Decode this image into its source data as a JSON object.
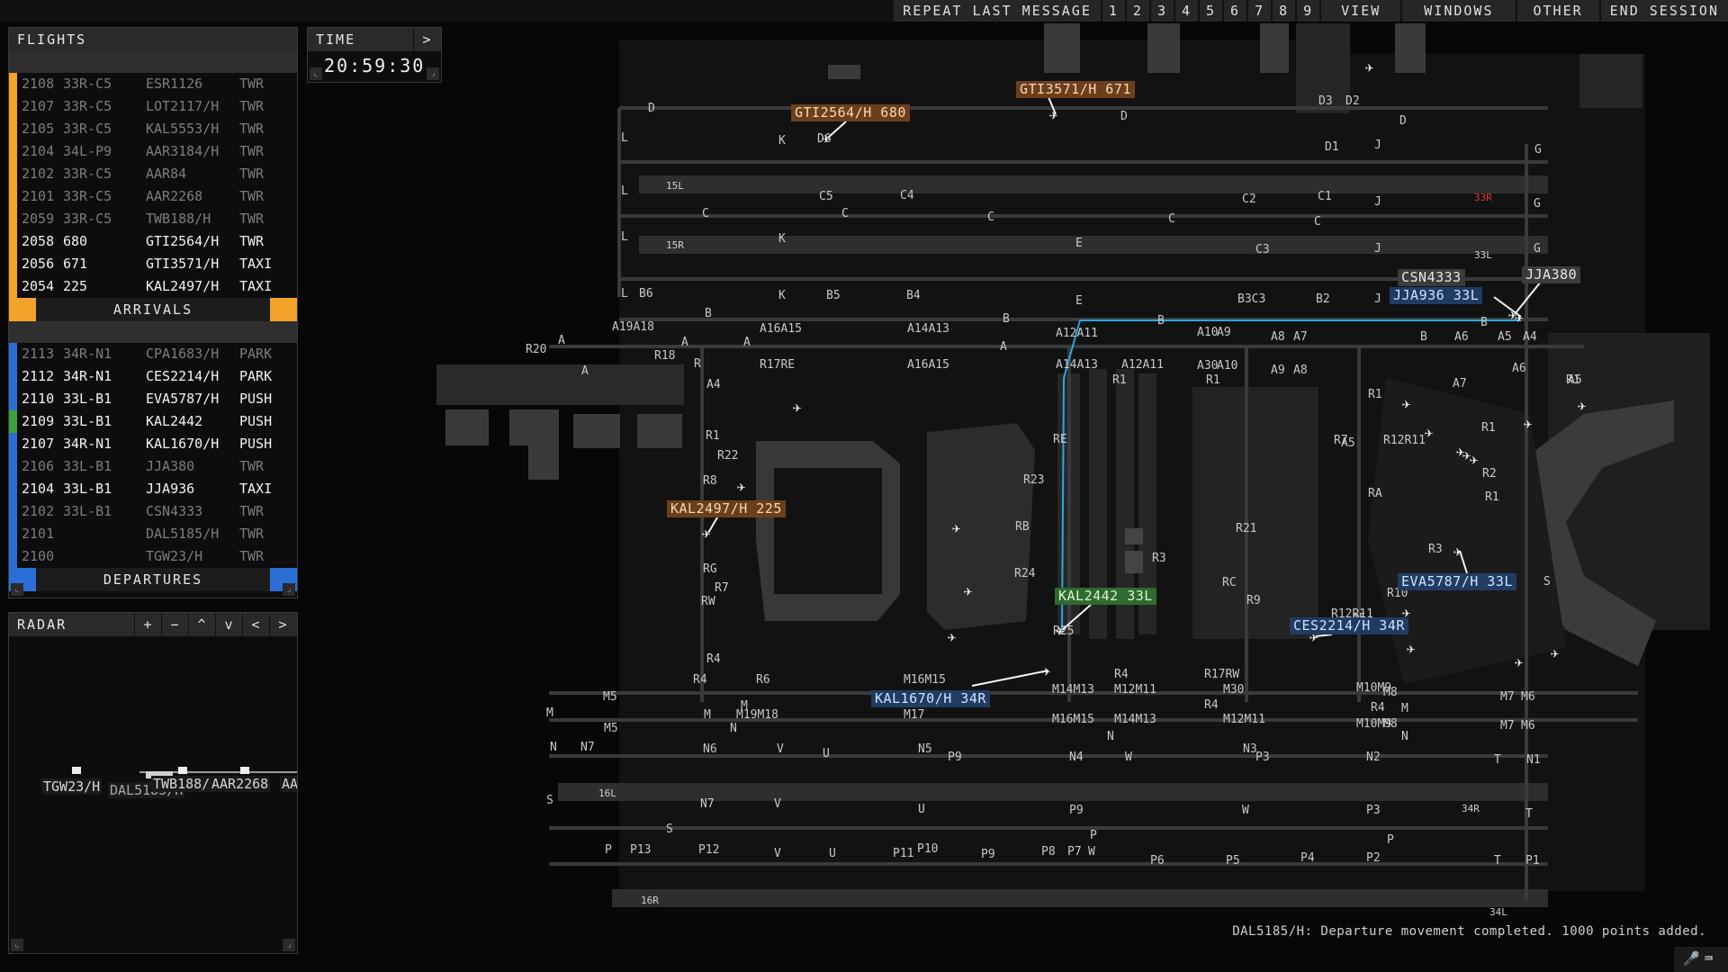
{
  "menu": {
    "repeat": "REPEAT LAST MESSAGE",
    "numbers": [
      "1",
      "2",
      "3",
      "4",
      "5",
      "6",
      "7",
      "8",
      "9"
    ],
    "view": "VIEW",
    "windows": "WINDOWS",
    "other": "OTHER",
    "end": "END SESSION"
  },
  "flights": {
    "title": "FLIGHTS",
    "arrivals_label": "ARRIVALS",
    "departures_label": "DEPARTURES",
    "arrivals": [
      {
        "time": "2108",
        "gate": "33R-C5",
        "callsign": "ESR1126",
        "state": "TWR",
        "dim": true,
        "color": "#f4a32a"
      },
      {
        "time": "2107",
        "gate": "33R-C5",
        "callsign": "LOT2117/H",
        "state": "TWR",
        "dim": true,
        "color": "#f4a32a"
      },
      {
        "time": "2105",
        "gate": "33R-C5",
        "callsign": "KAL5553/H",
        "state": "TWR",
        "dim": true,
        "color": "#f4a32a"
      },
      {
        "time": "2104",
        "gate": "34L-P9",
        "callsign": "AAR3184/H",
        "state": "TWR",
        "dim": true,
        "color": "#f4a32a"
      },
      {
        "time": "2102",
        "gate": "33R-C5",
        "callsign": "AAR84",
        "state": "TWR",
        "dim": true,
        "color": "#f4a32a"
      },
      {
        "time": "2101",
        "gate": "33R-C5",
        "callsign": "AAR2268",
        "state": "TWR",
        "dim": true,
        "color": "#f4a32a"
      },
      {
        "time": "2059",
        "gate": "33R-C5",
        "callsign": "TWB188/H",
        "state": "TWR",
        "dim": true,
        "color": "#f4a32a"
      },
      {
        "time": "2058",
        "gate": "680",
        "callsign": "GTI2564/H",
        "state": "TWR",
        "dim": false,
        "color": "#f4a32a"
      },
      {
        "time": "2056",
        "gate": "671",
        "callsign": "GTI3571/H",
        "state": "TAXI",
        "dim": false,
        "color": "#f4a32a"
      },
      {
        "time": "2054",
        "gate": "225",
        "callsign": "KAL2497/H",
        "state": "TAXI",
        "dim": false,
        "color": "#f4a32a"
      }
    ],
    "departures": [
      {
        "time": "2113",
        "gate": "34R-N1",
        "callsign": "CPA1683/H",
        "state": "PARK",
        "dim": true,
        "color": "#2b6fd6"
      },
      {
        "time": "2112",
        "gate": "34R-N1",
        "callsign": "CES2214/H",
        "state": "PARK",
        "dim": false,
        "color": "#2b6fd6"
      },
      {
        "time": "2110",
        "gate": "33L-B1",
        "callsign": "EVA5787/H",
        "state": "PUSH",
        "dim": false,
        "color": "#2b6fd6"
      },
      {
        "time": "2109",
        "gate": "33L-B1",
        "callsign": "KAL2442",
        "state": "PUSH",
        "dim": false,
        "color": "#3ba33b"
      },
      {
        "time": "2107",
        "gate": "34R-N1",
        "callsign": "KAL1670/H",
        "state": "PUSH",
        "dim": false,
        "color": "#2b6fd6"
      },
      {
        "time": "2106",
        "gate": "33L-B1",
        "callsign": "JJA380",
        "state": "TWR",
        "dim": true,
        "color": "#2b6fd6"
      },
      {
        "time": "2104",
        "gate": "33L-B1",
        "callsign": "JJA936",
        "state": "TAXI",
        "dim": false,
        "color": "#2b6fd6"
      },
      {
        "time": "2102",
        "gate": "33L-B1",
        "callsign": "CSN4333",
        "state": "TWR",
        "dim": true,
        "color": "#2b6fd6"
      },
      {
        "time": "2101",
        "gate": "",
        "callsign": "DAL5185/H",
        "state": "TWR",
        "dim": true,
        "color": "#2b6fd6"
      },
      {
        "time": "2100",
        "gate": "",
        "callsign": "TGW23/H",
        "state": "TWR",
        "dim": true,
        "color": "#2b6fd6"
      }
    ]
  },
  "time_panel": {
    "title": "TIME",
    "button": ">",
    "clock": "20:59:30"
  },
  "radar_panel": {
    "title": "RADAR",
    "buttons": [
      "+",
      "−",
      "^",
      "v",
      "<",
      ">"
    ],
    "labels": [
      "TGW23/H",
      "DAL5185/H",
      "TWB188/H",
      "AAR2268",
      "AAR"
    ]
  },
  "aircraft_tags": [
    {
      "id": "gti2564",
      "text": "GTI2564/H 680",
      "color": "orange"
    },
    {
      "id": "gti3571",
      "text": "GTI3571/H 671",
      "color": "orange"
    },
    {
      "id": "kal2497",
      "text": "KAL2497/H 225",
      "color": "orange"
    },
    {
      "id": "csn4333",
      "text": "CSN4333",
      "color": "grey"
    },
    {
      "id": "jja380",
      "text": "JJA380",
      "color": "grey"
    },
    {
      "id": "jja936",
      "text": "JJA936 33L",
      "color": "blue"
    },
    {
      "id": "eva5787",
      "text": "EVA5787/H 33L",
      "color": "blue"
    },
    {
      "id": "ces2214",
      "text": "CES2214/H 34R",
      "color": "blue"
    },
    {
      "id": "kal2442",
      "text": "KAL2442 33L",
      "color": "green"
    },
    {
      "id": "kal1670",
      "text": "KAL1670/H 34R",
      "color": "blue"
    }
  ],
  "runway_labels": [
    "15L",
    "15R",
    "33R",
    "33L",
    "16L",
    "16R",
    "34R",
    "34L"
  ],
  "taxiway_labels": [
    "D",
    "L",
    "K",
    "D6",
    "D",
    "D3",
    "D2",
    "D",
    "G",
    "D1",
    "J",
    "L",
    "C5",
    "C4",
    "C2",
    "C1",
    "J",
    "G",
    "C",
    "C",
    "C",
    "C",
    "C",
    "L",
    "K",
    "E",
    "C3",
    "J",
    "G",
    "L",
    "B6",
    "K",
    "B5",
    "B4",
    "E",
    "B3C3",
    "B2",
    "J",
    "A19A18",
    "B",
    "A16A15",
    "A14A13",
    "B",
    "A12A11",
    "B",
    "A10",
    "A9",
    "A8",
    "A7",
    "B",
    "A6",
    "B",
    "A5",
    "A4",
    "R20",
    "A",
    "R18",
    "A",
    "A",
    "A",
    "A",
    "R",
    "R17RE",
    "A16A15",
    "A14A13",
    "A12A11",
    "A30",
    "A10",
    "A9",
    "A8",
    "A7",
    "A6",
    "A5",
    "A4",
    "R1",
    "R1",
    "R1",
    "R1",
    "R1",
    "R1",
    "R22",
    "RE",
    "R12R11",
    "R7",
    "A5",
    "R8",
    "R23",
    "RA",
    "R2",
    "R1",
    "RB",
    "R21",
    "R3",
    "R3",
    "RG",
    "R24",
    "RC",
    "R9",
    "R10",
    "R7",
    "RW",
    "R25",
    "R12R11",
    "A5",
    "R4",
    "R4",
    "R17RW",
    "R4",
    "R4",
    "R4",
    "R6",
    "M16M15",
    "M14M13",
    "M12M11",
    "M30",
    "M10M9",
    "M8",
    "M7",
    "M6",
    "M5",
    "M",
    "M",
    "M",
    "M",
    "M19M18",
    "M17",
    "M16M15",
    "M14M13",
    "M12M11",
    "M10M9",
    "M8",
    "M7",
    "M6",
    "M5",
    "N",
    "N",
    "N",
    "N",
    "N7",
    "N6",
    "V",
    "U",
    "N5",
    "P9",
    "N4",
    "W",
    "N3",
    "P3",
    "N2",
    "T",
    "N1",
    "S",
    "N7",
    "V",
    "U",
    "P9",
    "W",
    "P3",
    "T",
    "S",
    "P",
    "P",
    "P",
    "P13",
    "P12",
    "V",
    "U",
    "P11",
    "P10",
    "P9",
    "P8",
    "P7",
    "W",
    "P6",
    "P5",
    "P4",
    "P2",
    "T",
    "P1",
    "S"
  ],
  "status_message": "DAL5185/H: Departure movement completed. 1000 points added.",
  "colors": {
    "arrival": "#f4a32a",
    "departure": "#2b6fd6",
    "ready": "#3ba33b",
    "route": "#27a8e0",
    "alert": "#e0303a"
  }
}
